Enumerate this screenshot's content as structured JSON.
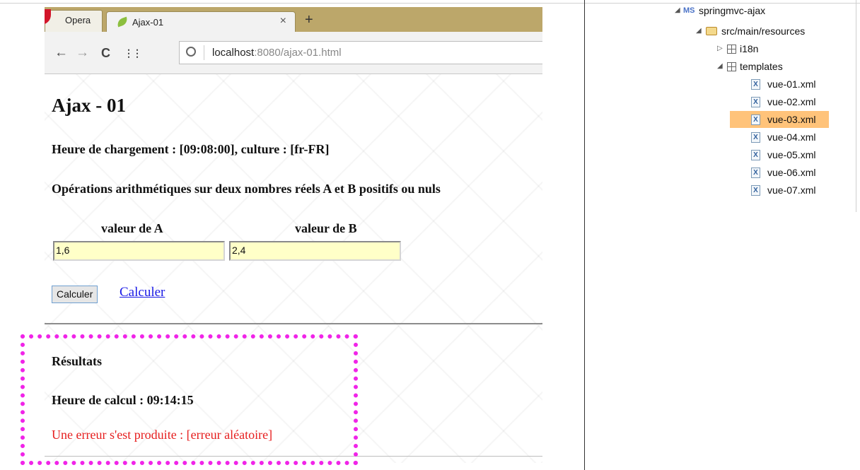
{
  "browser": {
    "tabs": [
      {
        "label": "Opera"
      },
      {
        "label": "Ajax-01",
        "close": "×"
      }
    ],
    "new_tab": "+",
    "nav": {
      "back": "←",
      "forward": "→",
      "reload": "C",
      "speed_dial": "⋮⋮"
    },
    "address": {
      "host": "localhost",
      "rest": ":8080/ajax-01.html"
    }
  },
  "page": {
    "title": "Ajax - 01",
    "load_info": "Heure de chargement : [09:08:00], culture : [fr-FR]",
    "description": "Opérations arithmétiques sur deux nombres réels A et B positifs ou nuls",
    "label_a": "valeur de A",
    "label_b": "valeur de B",
    "value_a": "1,6",
    "value_b": "2,4",
    "button_label": "Calculer",
    "link_label": "Calculer",
    "results": {
      "title": "Résultats",
      "time": "Heure de calcul : 09:14:15",
      "error": "Une erreur s'est produite : [erreur aléatoire]"
    }
  },
  "tree": {
    "project": "springmvc-ajax",
    "source_folder": "src/main/resources",
    "packages": [
      "i18n",
      "templates"
    ],
    "files": [
      "vue-01.xml",
      "vue-02.xml",
      "vue-03.xml",
      "vue-04.xml",
      "vue-05.xml",
      "vue-06.xml",
      "vue-07.xml"
    ],
    "selected": "vue-03.xml",
    "project_icon": "MS"
  },
  "colors": {
    "highlight": "#f024e8",
    "selection": "#ffc37a",
    "error": "#e61e1e",
    "link": "#1a1ae6"
  }
}
